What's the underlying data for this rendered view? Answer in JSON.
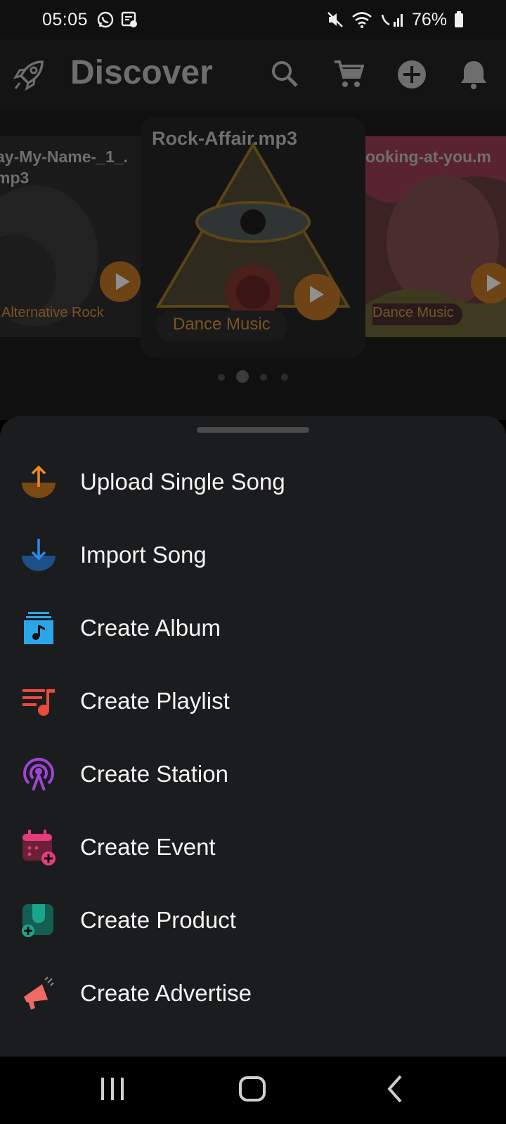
{
  "status": {
    "time": "05:05",
    "battery": "76%"
  },
  "header": {
    "title": "Discover"
  },
  "carousel": {
    "cards": [
      {
        "title_line1": "ay-My-Name-_1_.",
        "title_line2": "mp3",
        "genre": "Alternative Rock"
      },
      {
        "title": "Rock-Affair.mp3",
        "genre": "Dance Music"
      },
      {
        "title": "ooking-at-you.m",
        "genre": "Dance Music"
      }
    ]
  },
  "sheet": {
    "items": [
      {
        "label": "Upload Single Song",
        "icon": "upload-icon",
        "color": "#f08a24"
      },
      {
        "label": "Import Song",
        "icon": "import-icon",
        "color": "#2f8ae5"
      },
      {
        "label": "Create Album",
        "icon": "album-icon",
        "color": "#2aa6e8"
      },
      {
        "label": "Create Playlist",
        "icon": "playlist-icon",
        "color": "#e84a3c"
      },
      {
        "label": "Create Station",
        "icon": "station-icon",
        "color": "#a044d8"
      },
      {
        "label": "Create Event",
        "icon": "event-icon",
        "color": "#e33b7c"
      },
      {
        "label": "Create Product",
        "icon": "product-icon",
        "color": "#1aa58f"
      },
      {
        "label": "Create Advertise",
        "icon": "advertise-icon",
        "color": "#f06a64"
      }
    ]
  }
}
